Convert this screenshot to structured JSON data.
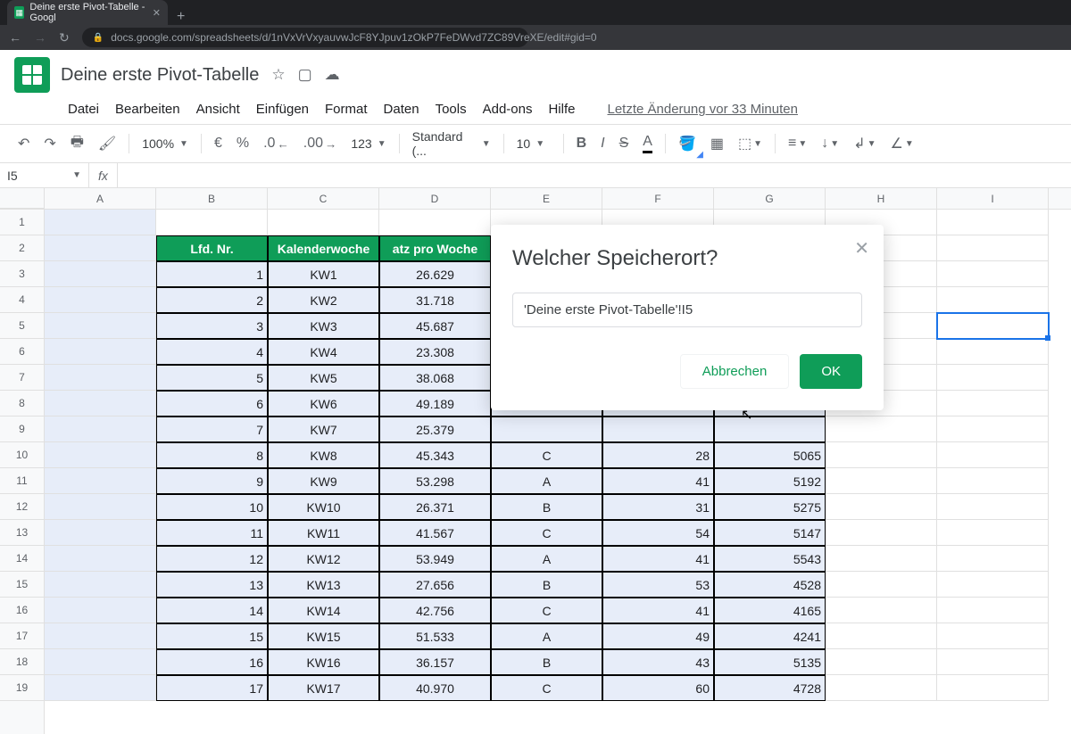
{
  "browser": {
    "tab_title": "Deine erste Pivot-Tabelle - Googl",
    "url": "docs.google.com/spreadsheets/d/1nVxVrVxyauvwJcF8YJpuv1zOkP7FeDWvd7ZC89VreXE/edit#gid=0"
  },
  "doc": {
    "title": "Deine erste Pivot-Tabelle",
    "last_edit": "Letzte Änderung vor 33 Minuten"
  },
  "menu": {
    "file": "Datei",
    "edit": "Bearbeiten",
    "view": "Ansicht",
    "insert": "Einfügen",
    "format": "Format",
    "data": "Daten",
    "tools": "Tools",
    "addons": "Add-ons",
    "help": "Hilfe"
  },
  "toolbar": {
    "zoom": "100%",
    "currency": "€",
    "percent": "%",
    "dec_dec": ".0",
    "dec_inc": ".00",
    "more_fmt": "123",
    "font": "Standard (...",
    "font_size": "10"
  },
  "formula": {
    "name_box": "I5",
    "fx": "fx"
  },
  "columns": [
    "A",
    "B",
    "C",
    "D",
    "E",
    "F",
    "G",
    "H",
    "I"
  ],
  "row_numbers": [
    "1",
    "2",
    "3",
    "4",
    "5",
    "6",
    "7",
    "8",
    "9",
    "10",
    "11",
    "12",
    "13",
    "14",
    "15",
    "16",
    "17",
    "18",
    "19"
  ],
  "sheet_headers": {
    "b": "Lfd. Nr.",
    "c": "Kalenderwoche",
    "d": "atz pro Woche"
  },
  "data": [
    {
      "nr": "1",
      "kw": "KW1",
      "atz": "26.629",
      "e": "",
      "f": "",
      "g": ""
    },
    {
      "nr": "2",
      "kw": "KW2",
      "atz": "31.718",
      "e": "",
      "f": "",
      "g": ""
    },
    {
      "nr": "3",
      "kw": "KW3",
      "atz": "45.687",
      "e": "",
      "f": "",
      "g": ""
    },
    {
      "nr": "4",
      "kw": "KW4",
      "atz": "23.308",
      "e": "",
      "f": "",
      "g": ""
    },
    {
      "nr": "5",
      "kw": "KW5",
      "atz": "38.068",
      "e": "",
      "f": "",
      "g": ""
    },
    {
      "nr": "6",
      "kw": "KW6",
      "atz": "49.189",
      "e": "",
      "f": "",
      "g": ""
    },
    {
      "nr": "7",
      "kw": "KW7",
      "atz": "25.379",
      "e": "",
      "f": "",
      "g": ""
    },
    {
      "nr": "8",
      "kw": "KW8",
      "atz": "45.343",
      "e": "C",
      "f": "28",
      "g": "5065"
    },
    {
      "nr": "9",
      "kw": "KW9",
      "atz": "53.298",
      "e": "A",
      "f": "41",
      "g": "5192"
    },
    {
      "nr": "10",
      "kw": "KW10",
      "atz": "26.371",
      "e": "B",
      "f": "31",
      "g": "5275"
    },
    {
      "nr": "11",
      "kw": "KW11",
      "atz": "41.567",
      "e": "C",
      "f": "54",
      "g": "5147"
    },
    {
      "nr": "12",
      "kw": "KW12",
      "atz": "53.949",
      "e": "A",
      "f": "41",
      "g": "5543"
    },
    {
      "nr": "13",
      "kw": "KW13",
      "atz": "27.656",
      "e": "B",
      "f": "53",
      "g": "4528"
    },
    {
      "nr": "14",
      "kw": "KW14",
      "atz": "42.756",
      "e": "C",
      "f": "41",
      "g": "4165"
    },
    {
      "nr": "15",
      "kw": "KW15",
      "atz": "51.533",
      "e": "A",
      "f": "49",
      "g": "4241"
    },
    {
      "nr": "16",
      "kw": "KW16",
      "atz": "36.157",
      "e": "B",
      "f": "43",
      "g": "5135"
    },
    {
      "nr": "17",
      "kw": "KW17",
      "atz": "40.970",
      "e": "C",
      "f": "60",
      "g": "4728"
    }
  ],
  "dialog": {
    "title": "Welcher Speicherort?",
    "value": "'Deine erste Pivot-Tabelle'!I5",
    "cancel": "Abbrechen",
    "ok": "OK"
  }
}
